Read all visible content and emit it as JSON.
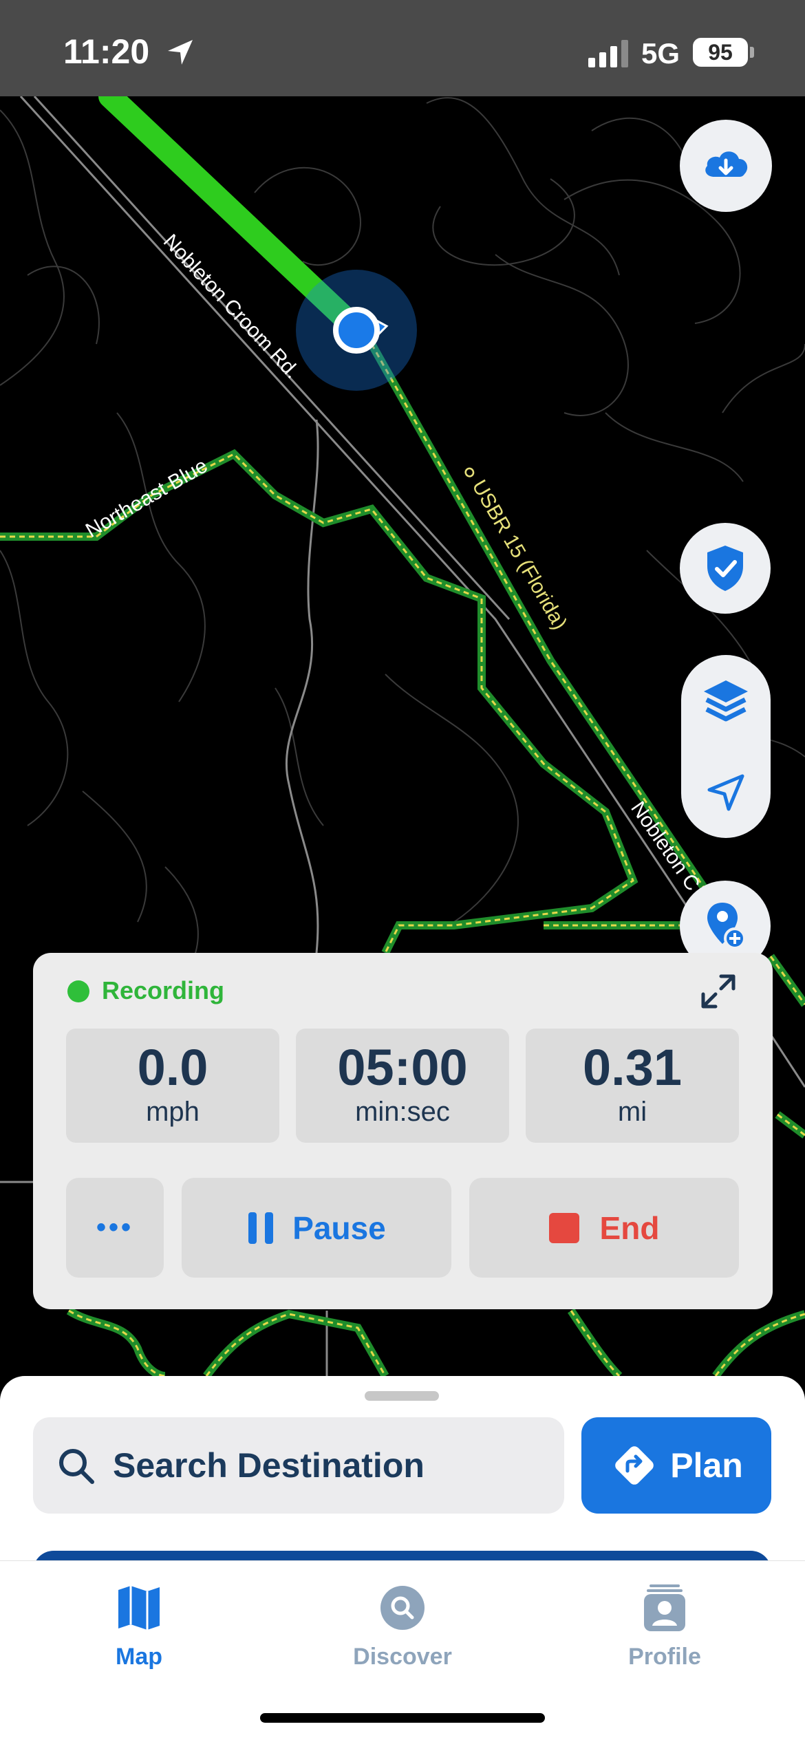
{
  "status_bar": {
    "time": "11:20",
    "network": "5G",
    "battery": "95"
  },
  "map": {
    "road_labels": [
      "Nobleton Croom Rd.",
      "Northeast Blue",
      "๐ USBR 15 (Florida)",
      "Nobleton C"
    ],
    "colors": {
      "route": "#2ecc1e",
      "trail": "#1e8a2a",
      "trail_dash": "#e6d84a",
      "road": "#8a8a8a",
      "contour": "#3a3a3a",
      "position": "#1a7ae8"
    }
  },
  "side_buttons": {
    "download_icon": "cloud-download-icon",
    "shield_icon": "shield-check-icon",
    "layers_icon": "layers-icon",
    "locate_icon": "navigation-arrow-icon",
    "add_pin_icon": "add-pin-icon"
  },
  "recording": {
    "status": "Recording",
    "stats": [
      {
        "value": "0.0",
        "unit": "mph"
      },
      {
        "value": "05:00",
        "unit": "min:sec"
      },
      {
        "value": "0.31",
        "unit": "mi"
      }
    ],
    "more_label": "•••",
    "pause_label": "Pause",
    "end_label": "End",
    "colors": {
      "accent": "#1a76e0",
      "stop": "#e5483f",
      "recording": "#2fbf3a"
    }
  },
  "sheet": {
    "search_placeholder": "Search Destination",
    "plan_label": "Plan"
  },
  "tabs": [
    {
      "label": "Map",
      "icon": "map-icon",
      "active": true
    },
    {
      "label": "Discover",
      "icon": "discover-icon",
      "active": false
    },
    {
      "label": "Profile",
      "icon": "profile-icon",
      "active": false
    }
  ]
}
